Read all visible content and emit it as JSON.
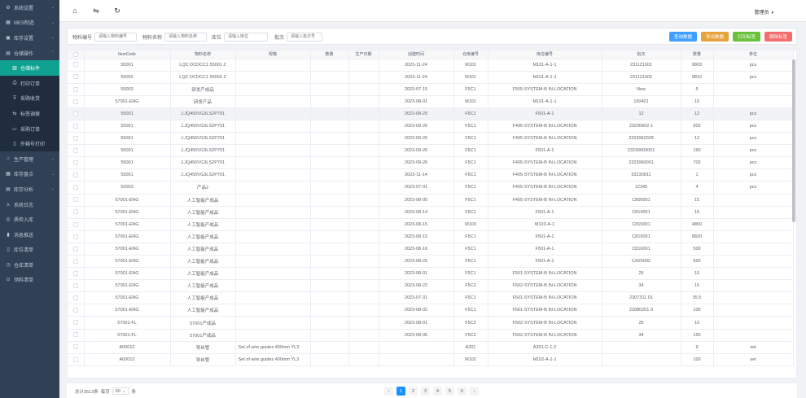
{
  "sidebar": {
    "items": [
      {
        "label": "系统设置",
        "icon": "gear-icon",
        "glyph": "⚙",
        "sub": false,
        "active": false,
        "arrow": "⌄"
      },
      {
        "label": "MES制造",
        "icon": "grid-icon",
        "glyph": "▦",
        "sub": false,
        "active": false,
        "arrow": "⌄"
      },
      {
        "label": "库存设置",
        "icon": "box-icon",
        "glyph": "▣",
        "sub": false,
        "active": false,
        "arrow": "⌄"
      },
      {
        "label": "仓储操作",
        "icon": "warehouse-icon",
        "glyph": "▤",
        "sub": false,
        "active": false,
        "arrow": "⌃"
      },
      {
        "label": "仓储标件",
        "icon": "tag-icon",
        "glyph": "▥",
        "sub": true,
        "active": true,
        "arrow": ""
      },
      {
        "label": "打印订单",
        "icon": "printer-icon",
        "glyph": "⎙",
        "sub": true,
        "active": false,
        "arrow": ""
      },
      {
        "label": "采购收货",
        "icon": "receive-icon",
        "glyph": "⊽",
        "sub": true,
        "active": false,
        "arrow": ""
      },
      {
        "label": "标签调拨",
        "icon": "transfer-icon",
        "glyph": "⇆",
        "sub": true,
        "active": false,
        "arrow": ""
      },
      {
        "label": "采购订单",
        "icon": "order-icon",
        "glyph": "▭",
        "sub": true,
        "active": false,
        "arrow": ""
      },
      {
        "label": "外箱号打印",
        "icon": "label-icon",
        "glyph": "▯",
        "sub": true,
        "active": false,
        "arrow": ""
      },
      {
        "label": "生产管理",
        "icon": "factory-icon",
        "glyph": "⌂",
        "sub": false,
        "active": false,
        "arrow": "⌄"
      },
      {
        "label": "库存盘点",
        "icon": "inventory-icon",
        "glyph": "▦",
        "sub": false,
        "active": false,
        "arrow": "⌄"
      },
      {
        "label": "库存分析",
        "icon": "analysis-icon",
        "glyph": "▤",
        "sub": false,
        "active": false,
        "arrow": "⌄"
      },
      {
        "label": "系统日志",
        "icon": "log-icon",
        "glyph": "⋏",
        "sub": false,
        "active": false,
        "arrow": ""
      },
      {
        "label": "质检入库",
        "icon": "inspect-icon",
        "glyph": "◎",
        "sub": false,
        "active": false,
        "arrow": ""
      },
      {
        "label": "消息推送",
        "icon": "message-icon",
        "glyph": "▮",
        "sub": false,
        "active": false,
        "arrow": ""
      },
      {
        "label": "库位清单",
        "icon": "location-icon",
        "glyph": "▯",
        "sub": false,
        "active": false,
        "arrow": ""
      },
      {
        "label": "仓库清单",
        "icon": "store-icon",
        "glyph": "◷",
        "sub": false,
        "active": false,
        "arrow": ""
      },
      {
        "label": "领料清单",
        "icon": "pick-icon",
        "glyph": "⊙",
        "sub": false,
        "active": false,
        "arrow": ""
      }
    ]
  },
  "topbar": {
    "user": "管理员",
    "user_caret": "▾",
    "home_glyph": "⌂",
    "toggle_glyph": "⇋",
    "refresh_glyph": "↻"
  },
  "search": {
    "f1_label": "物料编号",
    "f1_placeholder": "请输入物料编号",
    "f2_label": "物料名称",
    "f2_placeholder": "请输入物料名称",
    "f3_label": "库位",
    "f3_placeholder": "请输入库位",
    "f4_label": "批次",
    "f4_placeholder": "请输入批次号",
    "btn_search": "查询数据",
    "btn_export": "导出数据",
    "btn_print": "打印标签",
    "btn_delete": "删除标签",
    "colors": {
      "search": "#409eff",
      "export": "#e6a23c",
      "print": "#67c23a",
      "delete": "#f56c6c"
    }
  },
  "table": {
    "headers": [
      "",
      "ItemCode",
      "物料名称",
      "规格",
      "数量",
      "生产日期",
      "创建时间",
      "仓库编号",
      "库位编号",
      "批次",
      "数量",
      "单位"
    ],
    "rows": [
      [
        "",
        "55001",
        "LQC DCDCC1 55001 Z",
        "",
        "",
        "",
        "2023-11-24",
        "M101",
        "M101-A-1-1",
        "231121001",
        "9803",
        "pcs"
      ],
      [
        "",
        "55002",
        "LQC DCDCC1 55002 Z",
        "",
        "",
        "",
        "2023-11-24",
        "M101",
        "M101-A-1-1",
        "231121002",
        "9810",
        "pcs"
      ],
      [
        "",
        "55003",
        "研发产成品",
        "",
        "",
        "",
        "2023-07-15",
        "F5C1",
        "F505-SYSTEM-B IN-LOCATION",
        "New",
        "5",
        ""
      ],
      [
        "",
        "57001-ENG",
        "研发产品",
        "",
        "",
        "",
        "2023-08-01",
        "M101",
        "M101-A-1-1",
        "100401",
        "10",
        ""
      ],
      [
        "",
        "55001",
        "J.JQ450VG3LS2P701",
        "",
        "",
        "",
        "2023-08-29",
        "F5C1",
        "F501-A-1",
        "12",
        "12",
        "pcs"
      ],
      [
        "",
        "55001",
        "J.JQ450VG3LS2P701",
        "",
        "",
        "",
        "2023-09-26",
        "F5C1",
        "F405-SYSTEM-B IN-LOCATION",
        "23230602-1",
        "503",
        "pcs"
      ],
      [
        "",
        "55001",
        "J.JQ450VG3LS2P701",
        "",
        "",
        "",
        "2023-09-26",
        "F5C1",
        "F405-SYSTEM-B IN-LOCATION",
        "2323062028",
        "12",
        "pcs"
      ],
      [
        "",
        "55001",
        "J.JQ450VG3LS2P701",
        "",
        "",
        "",
        "2023-09-26",
        "F5C1",
        "F501-A-1",
        "23230600001",
        "160",
        "pcs"
      ],
      [
        "",
        "55001",
        "J.JQ450VG3LS2P701",
        "",
        "",
        "",
        "2023-09-26",
        "F5C1",
        "F405-SYSTEM-B IN-LOCATION",
        "2323060001",
        "703",
        "pcs"
      ],
      [
        "",
        "55001",
        "J.JQ450VG3LS2P701",
        "",
        "",
        "",
        "2023-11-14",
        "F5C1",
        "F405-SYSTEM-B IN-LOCATION",
        "53230911",
        "1",
        "pcs"
      ],
      [
        "",
        "55003",
        "产品2",
        "",
        "",
        "",
        "2023-07-01",
        "F5C1",
        "F405-SYSTEM-B IN-LOCATION",
        "12345",
        "4",
        "pcs"
      ],
      [
        "",
        "57001-ENG",
        "人工智能产成品",
        "",
        "",
        "",
        "2023-08-05",
        "F5C1",
        "F405-SYSTEM-B IN-LOCATION",
        "C800001",
        "15",
        ""
      ],
      [
        "",
        "57001-ENG",
        "人工智能产成品",
        "",
        "",
        "",
        "2023-08-14",
        "F5C1",
        "F501-A-1",
        "C814001",
        "15",
        ""
      ],
      [
        "",
        "57001-ENG",
        "人工智能产成品",
        "",
        "",
        "",
        "2023-08-15",
        "M103",
        "M103-A-1",
        "C815001",
        "4850",
        ""
      ],
      [
        "",
        "57001-ENG",
        "人工智能产成品",
        "",
        "",
        "",
        "2023-08-15",
        "F5C1",
        "F501-A-1",
        "C815001",
        "8820",
        ""
      ],
      [
        "",
        "57001-ENG",
        "人工智能产成品",
        "",
        "",
        "",
        "2023-08-16",
        "F5C1",
        "F501-A-1",
        "C816001",
        "500",
        ""
      ],
      [
        "",
        "57001-ENG",
        "人工智能产成品",
        "",
        "",
        "",
        "2023-08-25",
        "F5C1",
        "F501-A-1",
        "CA25002",
        "500",
        ""
      ],
      [
        "",
        "57001-ENG",
        "人工智能产成品",
        "",
        "",
        "",
        "2023-08-01",
        "F5C1",
        "F501-SYSTEM-B IN-LOCATION",
        "25",
        "10",
        ""
      ],
      [
        "",
        "57001-ENG",
        "人工智能产成品",
        "",
        "",
        "",
        "2023-08-22",
        "F5C2",
        "F502-SYSTEM-B IN-LOCATION",
        "34",
        "15",
        ""
      ],
      [
        "",
        "57001-ENG",
        "人工智能产成品",
        "",
        "",
        "",
        "2023-07-31",
        "F5C1",
        "F501-SYSTEM-B IN-LOCATION",
        "2307311 01",
        "35.5",
        ""
      ],
      [
        "",
        "57001-ENG",
        "人工智能产成品",
        "",
        "",
        "",
        "2023-08-02",
        "F5C1",
        "F501-SYSTEM-B IN-LOCATION",
        "23080201-3",
        "100",
        ""
      ],
      [
        "",
        "57001-FL",
        "57001产成品",
        "",
        "",
        "",
        "2023-08-01",
        "F5C2",
        "F502-SYSTEM-B IN-LOCATION",
        "25",
        "10",
        ""
      ],
      [
        "",
        "57001-FL",
        "57001产成品",
        "",
        "",
        "",
        "2023-08-05",
        "F5C2",
        "F502-SYSTEM-B IN-LOCATION",
        "34",
        "150",
        ""
      ],
      [
        "",
        "A00012",
        "导丝管",
        "Set of wire guides 400mm YL3",
        "",
        "",
        "",
        "A201",
        "A201-C-1-2",
        "",
        "9",
        "set"
      ],
      [
        "",
        "A00013",
        "导丝管",
        "Set of wire guides 400mm YL3",
        "",
        "",
        "",
        "M102",
        "M102-A-1-1",
        "",
        "100",
        "set"
      ]
    ]
  },
  "pager": {
    "total": "总计3513条",
    "per_label": "每页",
    "per_value": "50",
    "per_unit": "条",
    "prev": "‹",
    "next": "›",
    "pages": [
      "1",
      "2",
      "3",
      "4",
      "5",
      "6"
    ]
  }
}
